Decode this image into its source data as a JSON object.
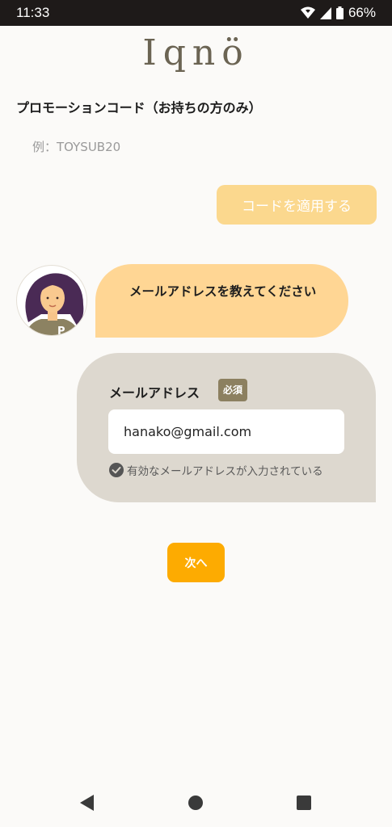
{
  "status_bar": {
    "time": "11:33",
    "battery": "66%",
    "icons": [
      "wifi-icon",
      "cell-signal-icon",
      "battery-icon"
    ]
  },
  "app": {
    "logo": "Iqnö"
  },
  "promo": {
    "title": "プロモーションコード（お持ちの方のみ）",
    "placeholder": "例：TOYSUB20",
    "value": "",
    "apply_label": "コードを適用する"
  },
  "chat": {
    "avatar_icon": "avatar-woman-icon",
    "bot_message": "メールアドレスを教えてください"
  },
  "email_form": {
    "label": "メールアドレス",
    "required_badge": "必須",
    "value": "hanako@gmail.com",
    "validation_message": "有効なメールアドレスが入力されている",
    "validation_icon": "check-circle-icon"
  },
  "next_button": {
    "label": "次へ"
  },
  "nav": {
    "icons": [
      "back-icon",
      "home-icon",
      "recents-icon"
    ]
  },
  "colors": {
    "accent": "#fdab01",
    "apply_disabled": "#fbd88e",
    "bubble": "#ffd694",
    "card": "#ddd8cf",
    "badge": "#8c8060",
    "logo": "#6b6453",
    "status_bar": "#1e1a19"
  }
}
